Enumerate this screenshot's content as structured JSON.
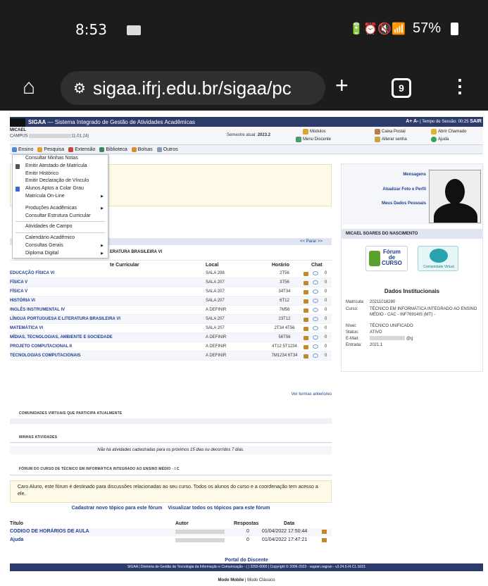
{
  "status_bar": {
    "time": "8:53",
    "battery": "57%"
  },
  "browser": {
    "url": "sigaa.ifrj.edu.br/sigaa/pc",
    "tab_count": "9"
  },
  "header": {
    "app": "SIGAA",
    "title": "Sistema Integrado de Gestão de Atividades Acadêmicas",
    "font_controls": "A+ A-",
    "session_label": "Tempo de Sessão: 00:25",
    "logout": "SAIR"
  },
  "user": {
    "name": "MICAEL",
    "campus": "CAMPUS",
    "campus_suffix": "11.01.24)",
    "semester_label": "Semestre atual:",
    "semester_value": "2023.2"
  },
  "quick_links": {
    "modulos": "Módulos",
    "caixa_postal": "Caixa Postal",
    "abrir_chamado": "Abrir Chamado",
    "menu_discente": "Menu Discente",
    "alterar_senha": "Alterar senha",
    "ajuda": "Ajuda"
  },
  "menu": [
    "Ensino",
    "Pesquisa",
    "Extensão",
    "Biblioteca",
    "Bolsas",
    "Outros"
  ],
  "dropdown": {
    "group1": [
      "Consultar Minhas Notas",
      "Emitir Atestado de Matrícula",
      "Emitir Histórico",
      "Emitir Declaração de Vínculo",
      "Alunos Aptos a Colar Grau",
      "Matrícula On-Line"
    ],
    "group2": [
      "Produções Acadêmicas",
      "Consultar Estrutura Curricular"
    ],
    "group3": [
      "Atividades de Campo"
    ],
    "group4": [
      "Calendário Acadêmico",
      "Consultas Gerais",
      "Diploma Digital"
    ]
  },
  "turmas": {
    "parar": "<< Parar >>",
    "partial_title": "ERATURA BRASILEIRA VI",
    "col_componente": "te Curricular",
    "col_local": "Local",
    "col_horario": "Horário",
    "col_chat": "Chat",
    "rows": [
      {
        "nome": "EDUCAÇÃO FÍSICA VI",
        "local": "SALA 208",
        "horario": "2T56",
        "chat": "0"
      },
      {
        "nome": "FÍSICA V",
        "local": "SALA 207",
        "horario": "3T56",
        "chat": "0"
      },
      {
        "nome": "FÍSICA V",
        "local": "SALA 207",
        "horario": "34T34",
        "chat": "0"
      },
      {
        "nome": "HISTÓRIA VI",
        "local": "SALA 207",
        "horario": "6T12",
        "chat": "0"
      },
      {
        "nome": "INGLÊS INSTRUMENTAL IV",
        "local": "A DEFINIR",
        "horario": "7M56",
        "chat": "0"
      },
      {
        "nome": "LÍNGUA PORTUGUESA E LITERATURA BRASILEIRA VI",
        "local": "SALA 207",
        "horario": "23T12",
        "chat": "0"
      },
      {
        "nome": "MATEMÁTICA VI",
        "local": "SALA 207",
        "horario": "2T34 4T56",
        "chat": "0"
      },
      {
        "nome": "MÍDIAS, TECNOLOGIAS, AMBIENTE E SOCIEDADE",
        "local": "A DEFINIR",
        "horario": "56T56",
        "chat": "0"
      },
      {
        "nome": "PROJETO COMPUTACIONAL II",
        "local": "A DEFINIR",
        "horario": "4T12 5T1234",
        "chat": "0"
      },
      {
        "nome": "TECNOLOGIAS COMPUTACIONAIS",
        "local": "A DEFINIR",
        "horario": "7M1234 6T34",
        "chat": "0"
      }
    ],
    "ver_anteriores": "Ver turmas anteriores"
  },
  "comunidades": {
    "title": "COMUNIDADES VIRTUAIS QUE PARTICIPA ATUALMENTE"
  },
  "atividades": {
    "title": "MINHAS ATIVIDADES",
    "empty": "Não há atividades cadastradas para os próximos 15 dias ou decorridos 7 dias."
  },
  "forum": {
    "title": "FÓRUM DO CURSO DE TÉCNICO EM INFORMÁTICA INTEGRADO AO ENSINO MÉDIO - I C",
    "notice": "Caro Aluno, este fórum é destinado para discussões relacionadas ao seu curso. Todos os alunos do curso e a coordenação tem acesso a ele.",
    "link_new": "Cadastrar novo tópico para este fórum",
    "link_all": "Visualizar todos os tópicos para este fórum",
    "col_titulo": "Título",
    "col_autor": "Autor",
    "col_respostas": "Respostas",
    "col_data": "Data",
    "topics": [
      {
        "titulo": "CODIGO DE HORÁRIOS DE AULA",
        "respostas": "0",
        "data": "01/04/2022 17:50:44"
      },
      {
        "titulo": "Ajuda",
        "respostas": "0",
        "data": "01/04/2022 17:47:21"
      }
    ]
  },
  "portal": "Portal do Discente",
  "footer": "SIGAA | Diretoria de Gestão de Tecnologia da Informação e Comunicação - (  ) 3293-6000 | Copyright © 2006-2023 -  vagran.vagran - v3.24.5-I4.C1.S021",
  "mobile": {
    "mobile": "Modo Mobile",
    "sep": " | ",
    "classic": "Modo Clássico"
  },
  "profile": {
    "mensagens": "Mensagens",
    "atualizar": "Atualizar Foto e Perfil",
    "dados": "Meus Dados Pessoais",
    "full_name": "MICAEL SOARES DO NASCIMENTO",
    "forum_label_1": "Fórum",
    "forum_label_2": "de",
    "forum_label_3": "CURSO",
    "comunidade": "Comunidade Virtual",
    "dados_inst": "Dados Institucionais",
    "fields": [
      {
        "k": "Matrícula:",
        "v": "20211018280"
      },
      {
        "k": "Curso:",
        "v": "TÉCNICO EM INFORMÁTICA INTEGRADO AO ENSINO MÉDIO - CAC - INF76914IS (MT) -"
      },
      {
        "k": "Nível:",
        "v": "TÉCNICO UNIFICADO"
      },
      {
        "k": "Status:",
        "v": "ATIVO"
      },
      {
        "k": "E-Mail:",
        "v": "@g"
      },
      {
        "k": "Entrada:",
        "v": "2021.1"
      }
    ]
  }
}
